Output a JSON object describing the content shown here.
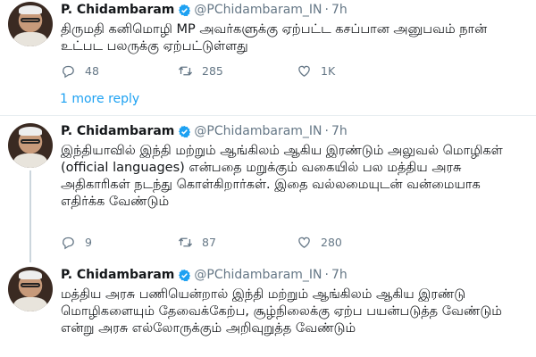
{
  "tweets": [
    {
      "name": "P. Chidambaram",
      "handle": "@PChidambaram_IN",
      "separator": "·",
      "time": "7h",
      "text": "திருமதி கனிமொழி MP அவர்களுக்கு ஏற்பட்ட கசப்பான அனுபவம் நான் உட்பட பலருக்கு ஏற்பட்டுள்ளது",
      "replies": "48",
      "retweets": "285",
      "likes": "1K"
    },
    {
      "name": "P. Chidambaram",
      "handle": "@PChidambaram_IN",
      "separator": "·",
      "time": "7h",
      "text": "இந்தியாவில் இந்தி மற்றும் ஆங்கிலம் ஆகிய இரண்டும் அலுவல் மொழிகள் (official languages) என்பதை மறுக்கும் வகையில் பல மத்திய அரசு அதிகாரிகள் நடந்து கொள்கிறார்கள். இதை வல்லமையுடன் வன்மையாக எதிர்க்க வேண்டும்",
      "replies": "9",
      "retweets": "87",
      "likes": "280"
    },
    {
      "name": "P. Chidambaram",
      "handle": "@PChidambaram_IN",
      "separator": "·",
      "time": "7h",
      "text": "மத்திய அரசு பணியென்றால் இந்தி மற்றும் ஆங்கிலம் ஆகிய இரண்டு மொழிகளையும் தேவைக்கேற்ப, சூழ்நிலைக்கு ஏற்ப பயன்படுத்த வேண்டும் என்று அரசு எல்லோருக்கும் அறிவுறுத்த வேண்டும்"
    }
  ],
  "more_replies": "1 more reply",
  "colors": {
    "accent": "#1da1f2",
    "muted": "#657786",
    "divider": "#e6ecf0"
  },
  "icons": [
    "reply-icon",
    "retweet-icon",
    "like-icon",
    "verified-badge-icon"
  ]
}
